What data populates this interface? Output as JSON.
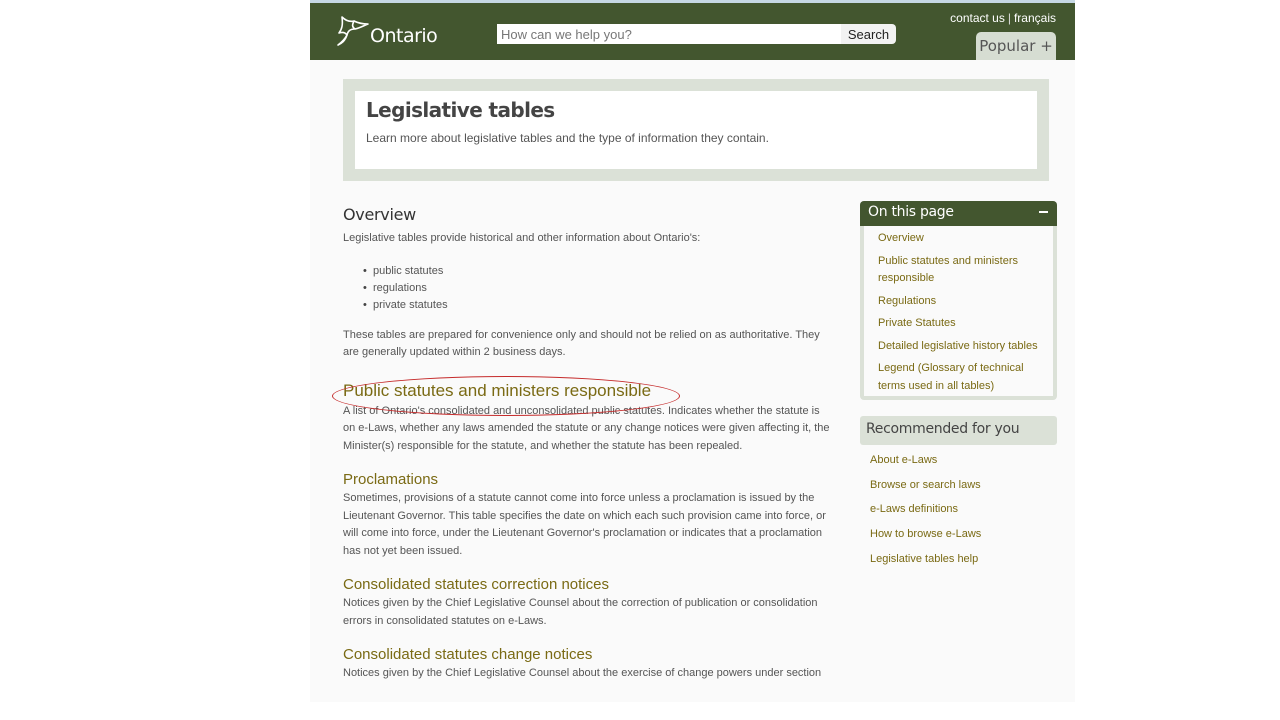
{
  "header": {
    "logo_text": "Ontario",
    "search_placeholder": "How can we help you?",
    "search_button": "Search",
    "contact_link": "contact us",
    "separator": "|",
    "language_link": "français",
    "popular_button": "Popular +"
  },
  "intro": {
    "title": "Legislative tables",
    "description": "Learn more about legislative tables and the type of information they contain."
  },
  "main": {
    "overview_heading": "Overview",
    "overview_intro": "Legislative tables provide historical and other information about Ontario's:",
    "overview_bullets": [
      "public statutes",
      "regulations",
      "private statutes"
    ],
    "overview_note": "These tables are prepared for convenience only and should not be relied on as authoritative. They are generally updated within 2 business days.",
    "sections": [
      {
        "heading": "Public statutes and ministers responsible",
        "body": "A list of Ontario's consolidated and unconsolidated public statutes. Indicates whether the statute is on e-Laws, whether any laws amended the statute or any change notices were given affecting it, the Minister(s) responsible for the statute, and whether the statute has been repealed."
      },
      {
        "heading": "Proclamations",
        "body": "Sometimes, provisions of a statute cannot come into force unless a proclamation is issued by the Lieutenant Governor. This table specifies the date on which each such provision came into force, or will come into force, under the Lieutenant Governor's proclamation or indicates that a proclamation has not yet been issued."
      },
      {
        "heading": "Consolidated statutes correction notices",
        "body": "Notices given by the Chief Legislative Counsel about the correction of publication or consolidation errors in consolidated statutes on e-Laws."
      },
      {
        "heading": "Consolidated statutes change notices",
        "body": "Notices given by the Chief Legislative Counsel about the exercise of change powers under section"
      }
    ]
  },
  "on_this_page": {
    "title": "On this page",
    "toggle": "collapse",
    "links": [
      "Overview",
      "Public statutes and ministers responsible",
      "Regulations",
      "Private Statutes",
      "Detailed legislative history tables",
      "Legend (Glossary of technical terms used in all tables)"
    ]
  },
  "recommended": {
    "title": "Recommended for you",
    "links": [
      "About e-Laws",
      "Browse or search laws",
      "e-Laws definitions",
      "How to browse e-Laws",
      "Legislative tables help"
    ]
  },
  "annotation": {
    "highlight_color": "#c52b2b",
    "highlighted_item": "Public statutes and ministers responsible"
  },
  "colors": {
    "brand_green": "#43562f",
    "link_olive": "#7a6a14",
    "panel_sage": "#dbe1d7"
  }
}
